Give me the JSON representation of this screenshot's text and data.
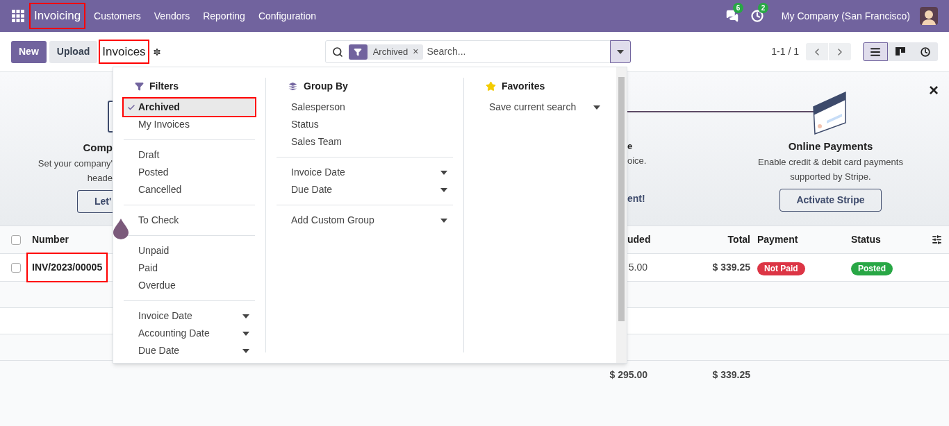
{
  "navbar": {
    "app_name": "Invoicing",
    "app_name_highlighted": true,
    "menu": [
      "Customers",
      "Vendors",
      "Reporting",
      "Configuration"
    ],
    "messages_badge": "6",
    "activities_badge": "2",
    "company": "My Company (San Francisco)"
  },
  "control_panel": {
    "buttons": [
      {
        "label": "New",
        "kind": "primary"
      },
      {
        "label": "Upload",
        "kind": "secondary"
      }
    ],
    "breadcrumb": "Invoices",
    "breadcrumb_highlighted": true,
    "search": {
      "facet": "Archived",
      "facet_remove": "×",
      "placeholder": "Search...",
      "expanded": true
    },
    "pager": "1-1 / 1",
    "views": [
      {
        "kind": "list",
        "selected": true
      },
      {
        "kind": "kanban",
        "selected": false
      },
      {
        "kind": "activity",
        "selected": false
      }
    ]
  },
  "banner": {
    "left_step": {
      "title": "Comp",
      "text_lines": [
        "Set your company'",
        "heade"
      ],
      "button": "Let'"
    },
    "middle_step": {
      "title": "e",
      "text": "oice.",
      "button": "ent!"
    },
    "right_step": {
      "title": "Online Payments",
      "text_lines": [
        "Enable credit & debit card payments",
        "supported by Stripe."
      ],
      "button": "Activate Stripe"
    },
    "close": "×"
  },
  "table": {
    "columns": [
      "Number",
      "uded",
      "Total",
      "Payment",
      "Status"
    ],
    "rows": [
      {
        "number": "INV/2023/00005",
        "highlighted": true,
        "checked": false,
        "amount": "5.00",
        "total": "$ 339.25",
        "payment": {
          "label": "Not Paid",
          "color": "#dc3545"
        },
        "status": {
          "label": "Posted",
          "color": "#28a745"
        }
      }
    ],
    "totals": [
      "$ 295.00",
      "$ 339.25"
    ],
    "select_all_checked": false
  },
  "search_panel": {
    "filters": {
      "title": "Filters",
      "groups": [
        [
          {
            "label": "Archived",
            "kind": "option",
            "checked": true,
            "highlighted": true
          },
          {
            "label": "My Invoices",
            "kind": "option",
            "checked": false,
            "highlighted": false
          }
        ],
        [
          {
            "label": "Draft",
            "kind": "option",
            "checked": false,
            "highlighted": false
          },
          {
            "label": "Posted",
            "kind": "option",
            "checked": false,
            "highlighted": false
          },
          {
            "label": "Cancelled",
            "kind": "option",
            "checked": false,
            "highlighted": false
          }
        ],
        [
          {
            "label": "To Check",
            "kind": "option",
            "checked": false,
            "highlighted": false
          }
        ],
        [
          {
            "label": "Unpaid",
            "kind": "option",
            "checked": false,
            "highlighted": false
          },
          {
            "label": "Paid",
            "kind": "option",
            "checked": false,
            "highlighted": false
          },
          {
            "label": "Overdue",
            "kind": "option",
            "checked": false,
            "highlighted": false
          }
        ],
        [
          {
            "label": "Invoice Date",
            "kind": "date"
          },
          {
            "label": "Accounting Date",
            "kind": "date"
          },
          {
            "label": "Due Date",
            "kind": "date"
          }
        ]
      ]
    },
    "group_by": {
      "title": "Group By",
      "groups": [
        [
          {
            "label": "Salesperson",
            "kind": "option",
            "checked": false,
            "highlighted": false
          },
          {
            "label": "Status",
            "kind": "option",
            "checked": false,
            "highlighted": false
          },
          {
            "label": "Sales Team",
            "kind": "option",
            "checked": false,
            "highlighted": false
          }
        ],
        [
          {
            "label": "Invoice Date",
            "kind": "date"
          },
          {
            "label": "Due Date",
            "kind": "date"
          }
        ],
        [
          {
            "label": "Add Custom Group",
            "kind": "select"
          }
        ]
      ]
    },
    "favorites": {
      "title": "Favorites",
      "groups": [
        [
          {
            "label": "Save current search",
            "kind": "menu"
          }
        ]
      ]
    }
  }
}
